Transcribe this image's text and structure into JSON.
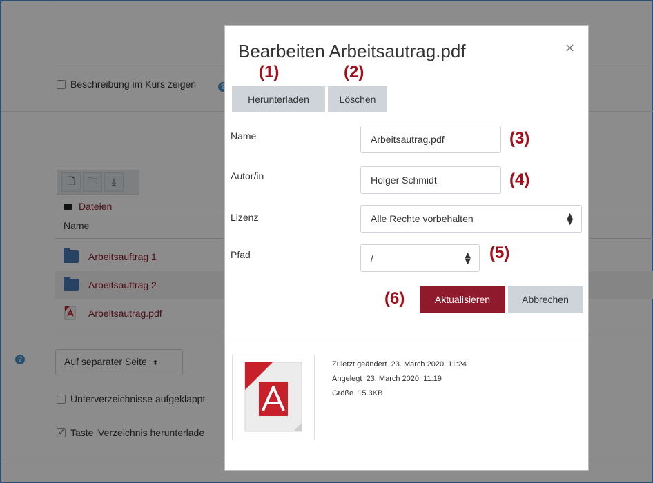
{
  "background": {
    "show_description_label": "Beschreibung im Kurs zeigen",
    "breadcrumb_root": "Dateien",
    "column_name": "Name",
    "files": [
      {
        "name": "Arbeitsauftrag 1",
        "type": "folder"
      },
      {
        "name": "Arbeitsauftrag 2",
        "type": "folder"
      },
      {
        "name": "Arbeitsautrag.pdf",
        "type": "pdf"
      }
    ],
    "display_select": "Auf separater Seite",
    "expand_subfolders_label": "Unterverzeichnisse aufgeklappt",
    "download_button_label": "Taste 'Verzeichnis herunterlade"
  },
  "modal": {
    "title": "Bearbeiten Arbeitsautrag.pdf",
    "close_glyph": "×",
    "download_button": "Herunterladen",
    "delete_button": "Löschen",
    "fields": {
      "name_label": "Name",
      "name_value": "Arbeitsautrag.pdf",
      "author_label": "Autor/in",
      "author_value": "Holger Schmidt",
      "license_label": "Lizenz",
      "license_value": "Alle Rechte vorbehalten",
      "path_label": "Pfad",
      "path_value": "/"
    },
    "update_button": "Aktualisieren",
    "cancel_button": "Abbrechen",
    "meta": {
      "modified_label": "Zuletzt geändert",
      "modified_value": "23. March 2020, 11:24",
      "created_label": "Angelegt",
      "created_value": "23. March 2020, 11:19",
      "size_label": "Größe",
      "size_value": "15.3KB"
    }
  },
  "annotations": [
    "(1)",
    "(2)",
    "(3)",
    "(4)",
    "(5)",
    "(6)"
  ],
  "colors": {
    "primary": "#8f1a2c",
    "annotation": "#a40f1c",
    "link": "#8b1a2c",
    "folder": "#4a79b7"
  }
}
